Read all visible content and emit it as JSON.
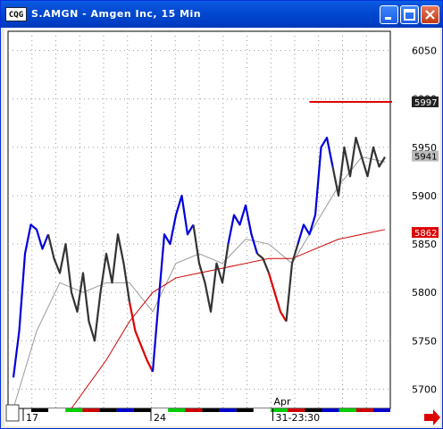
{
  "window": {
    "title": "S.AMGN - Amgen Inc, 15 Min",
    "icon_label": "CQG"
  },
  "toolbar_icons": [
    "minimize-icon",
    "maximize-icon",
    "close-icon"
  ],
  "colors": {
    "up_trend": "#0000dd",
    "down_trend": "#dd0000",
    "neutral": "#333333",
    "long_ma": "#cc0000",
    "short_ma": "#999999",
    "grid": "#999999"
  },
  "chart_data": {
    "type": "line",
    "title": "S.AMGN - Amgen Inc, 15 Min",
    "ylim": [
      5680,
      6070
    ],
    "y_ticks": [
      5700,
      5750,
      5800,
      5850,
      5900,
      5950,
      6000,
      6050
    ],
    "x_ticks": [
      "17",
      "24",
      "31-23:30"
    ],
    "x_annotation": "Apr",
    "price_tags": [
      {
        "label": "5997",
        "value": 5997,
        "style": "dark"
      },
      {
        "label": "5941",
        "value": 5941,
        "style": "gray"
      },
      {
        "label": "5862",
        "value": 5862,
        "style": "red"
      }
    ],
    "resistance_line": 5997,
    "series": [
      {
        "segments": [
          {
            "color": "blue",
            "points": [
              [
                0,
                5712
              ],
              [
                1,
                5760
              ],
              [
                2,
                5840
              ],
              [
                3,
                5870
              ],
              [
                4,
                5865
              ],
              [
                5,
                5845
              ],
              [
                6,
                5860
              ]
            ]
          },
          {
            "color": "black",
            "points": [
              [
                6,
                5860
              ],
              [
                7,
                5835
              ],
              [
                8,
                5820
              ],
              [
                9,
                5850
              ],
              [
                10,
                5800
              ],
              [
                11,
                5780
              ],
              [
                12,
                5820
              ],
              [
                13,
                5770
              ],
              [
                14,
                5750
              ],
              [
                15,
                5800
              ],
              [
                16,
                5840
              ],
              [
                17,
                5810
              ],
              [
                18,
                5860
              ],
              [
                19,
                5830
              ],
              [
                20,
                5790
              ]
            ]
          },
          {
            "color": "red",
            "points": [
              [
                20,
                5790
              ],
              [
                21,
                5760
              ],
              [
                22,
                5745
              ],
              [
                23,
                5730
              ],
              [
                24,
                5718
              ]
            ]
          },
          {
            "color": "blue",
            "points": [
              [
                24,
                5718
              ],
              [
                25,
                5790
              ],
              [
                26,
                5860
              ],
              [
                27,
                5850
              ],
              [
                28,
                5880
              ],
              [
                29,
                5900
              ],
              [
                30,
                5860
              ],
              [
                31,
                5870
              ]
            ]
          },
          {
            "color": "black",
            "points": [
              [
                31,
                5870
              ],
              [
                32,
                5830
              ],
              [
                33,
                5810
              ],
              [
                34,
                5780
              ],
              [
                35,
                5830
              ],
              [
                36,
                5810
              ],
              [
                37,
                5850
              ]
            ]
          },
          {
            "color": "blue",
            "points": [
              [
                37,
                5850
              ],
              [
                38,
                5880
              ],
              [
                39,
                5870
              ],
              [
                40,
                5890
              ],
              [
                41,
                5860
              ],
              [
                42,
                5840
              ]
            ]
          },
          {
            "color": "black",
            "points": [
              [
                42,
                5840
              ],
              [
                43,
                5835
              ],
              [
                44,
                5820
              ]
            ]
          },
          {
            "color": "red",
            "points": [
              [
                44,
                5820
              ],
              [
                45,
                5800
              ],
              [
                46,
                5780
              ],
              [
                47,
                5770
              ]
            ]
          },
          {
            "color": "black",
            "points": [
              [
                47,
                5770
              ],
              [
                48,
                5830
              ],
              [
                49,
                5850
              ]
            ]
          },
          {
            "color": "blue",
            "points": [
              [
                49,
                5850
              ],
              [
                50,
                5870
              ],
              [
                51,
                5860
              ],
              [
                52,
                5880
              ],
              [
                53,
                5950
              ],
              [
                54,
                5960
              ],
              [
                55,
                5930
              ]
            ]
          },
          {
            "color": "black",
            "points": [
              [
                55,
                5930
              ],
              [
                56,
                5900
              ],
              [
                57,
                5950
              ],
              [
                58,
                5920
              ],
              [
                59,
                5960
              ],
              [
                60,
                5940
              ],
              [
                61,
                5920
              ],
              [
                62,
                5950
              ],
              [
                63,
                5930
              ],
              [
                64,
                5940
              ]
            ]
          }
        ]
      },
      {
        "name": "",
        "color": "gray",
        "points": [
          [
            0,
            5680
          ],
          [
            4,
            5760
          ],
          [
            8,
            5810
          ],
          [
            12,
            5800
          ],
          [
            16,
            5810
          ],
          [
            20,
            5810
          ],
          [
            24,
            5780
          ],
          [
            28,
            5830
          ],
          [
            32,
            5840
          ],
          [
            36,
            5830
          ],
          [
            40,
            5855
          ],
          [
            44,
            5850
          ],
          [
            48,
            5830
          ],
          [
            52,
            5870
          ],
          [
            56,
            5910
          ],
          [
            60,
            5940
          ],
          [
            64,
            5935
          ]
        ]
      },
      {
        "name": "",
        "color": "red",
        "points": [
          [
            10,
            5680
          ],
          [
            16,
            5730
          ],
          [
            20,
            5770
          ],
          [
            24,
            5800
          ],
          [
            28,
            5815
          ],
          [
            32,
            5820
          ],
          [
            36,
            5825
          ],
          [
            40,
            5830
          ],
          [
            44,
            5835
          ],
          [
            48,
            5835
          ],
          [
            52,
            5845
          ],
          [
            56,
            5855
          ],
          [
            60,
            5860
          ],
          [
            64,
            5865
          ]
        ]
      }
    ]
  }
}
